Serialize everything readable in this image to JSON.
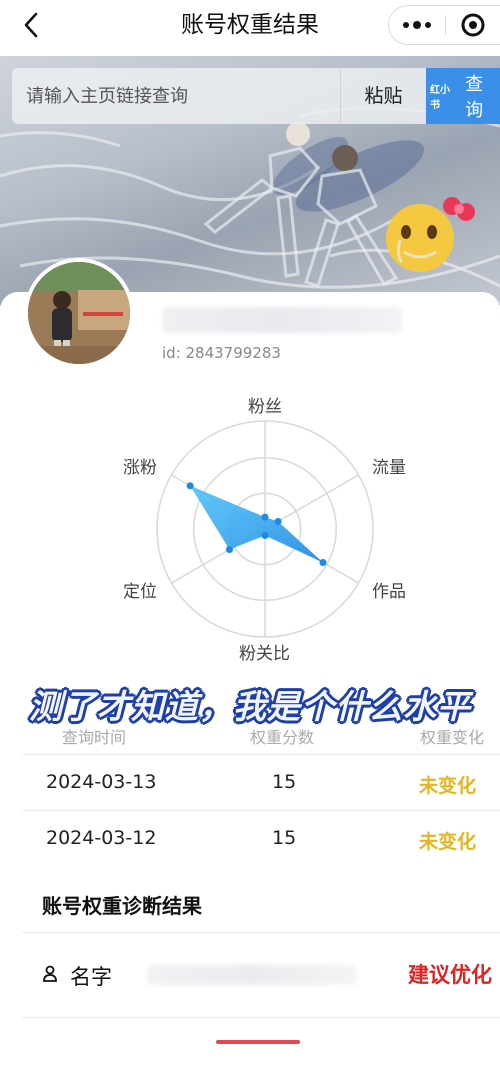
{
  "nav": {
    "title": "账号权重结果"
  },
  "search": {
    "placeholder": "请输入主页链接查询",
    "paste_label": "粘贴",
    "app_badge": "红小书",
    "query_label": "查询"
  },
  "profile": {
    "id_text": "id: 2843799283"
  },
  "radar": {
    "labels": {
      "fans": "粉丝",
      "traffic": "流量",
      "works": "作品",
      "fan_ratio": "粉关比",
      "location": "定位",
      "growth": "涨粉"
    },
    "values": {
      "fans": 0.11,
      "traffic": 0.14,
      "works": 0.62,
      "fan_ratio": 0.06,
      "location": 0.38,
      "growth": 0.8
    },
    "colors": {
      "fill_start": "#4fc3f7",
      "fill_end": "#1e88e5",
      "point": "#1e88e5",
      "grid": "#d8d8d8"
    }
  },
  "overlay": {
    "caption": "测了才知道，我是个什么水平"
  },
  "table": {
    "headers": [
      "查询时间",
      "权重分数",
      "权重变化"
    ],
    "rows": [
      {
        "date": "2024-03-13",
        "value": "15",
        "status": "未变化"
      },
      {
        "date": "2024-03-12",
        "value": "15",
        "status": "未变化"
      }
    ],
    "status_color": "#e6b422"
  },
  "diagnosis": {
    "title": "账号权重诊断结果",
    "name_label": "名字",
    "suggestion": "建议优化",
    "suggestion_color": "#e02222"
  }
}
